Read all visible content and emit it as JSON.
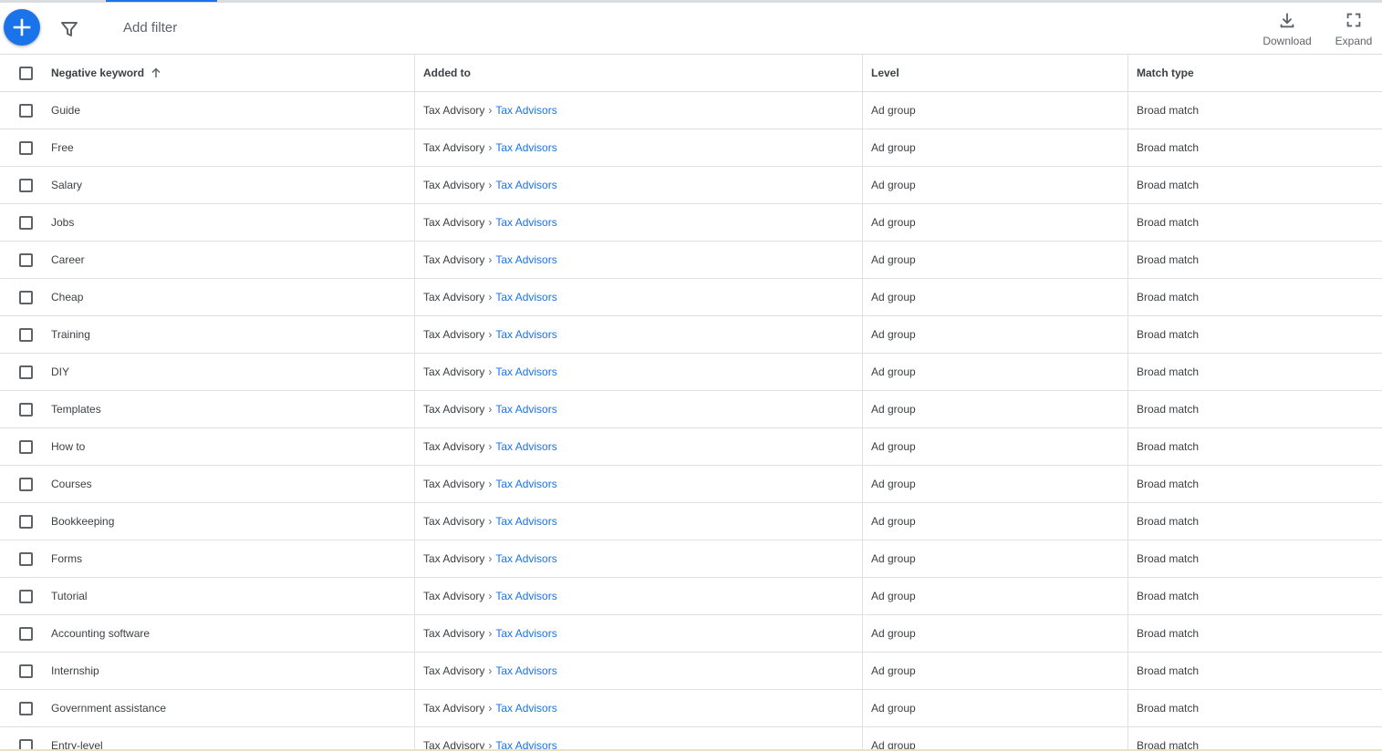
{
  "toolbar": {
    "add_filter_label": "Add filter",
    "download_label": "Download",
    "expand_label": "Expand"
  },
  "table": {
    "columns": {
      "keyword": "Negative keyword",
      "added_to": "Added to",
      "level": "Level",
      "match_type": "Match type"
    },
    "rows": [
      {
        "keyword": "Guide",
        "campaign": "Tax Advisory",
        "separator": "›",
        "ad_group": "Tax Advisors",
        "level": "Ad group",
        "match": "Broad match"
      },
      {
        "keyword": "Free",
        "campaign": "Tax Advisory",
        "separator": "›",
        "ad_group": "Tax Advisors",
        "level": "Ad group",
        "match": "Broad match"
      },
      {
        "keyword": "Salary",
        "campaign": "Tax Advisory",
        "separator": "›",
        "ad_group": "Tax Advisors",
        "level": "Ad group",
        "match": "Broad match"
      },
      {
        "keyword": "Jobs",
        "campaign": "Tax Advisory",
        "separator": "›",
        "ad_group": "Tax Advisors",
        "level": "Ad group",
        "match": "Broad match"
      },
      {
        "keyword": "Career",
        "campaign": "Tax Advisory",
        "separator": "›",
        "ad_group": "Tax Advisors",
        "level": "Ad group",
        "match": "Broad match"
      },
      {
        "keyword": "Cheap",
        "campaign": "Tax Advisory",
        "separator": "›",
        "ad_group": "Tax Advisors",
        "level": "Ad group",
        "match": "Broad match"
      },
      {
        "keyword": "Training",
        "campaign": "Tax Advisory",
        "separator": "›",
        "ad_group": "Tax Advisors",
        "level": "Ad group",
        "match": "Broad match"
      },
      {
        "keyword": "DIY",
        "campaign": "Tax Advisory",
        "separator": "›",
        "ad_group": "Tax Advisors",
        "level": "Ad group",
        "match": "Broad match"
      },
      {
        "keyword": "Templates",
        "campaign": "Tax Advisory",
        "separator": "›",
        "ad_group": "Tax Advisors",
        "level": "Ad group",
        "match": "Broad match"
      },
      {
        "keyword": "How to",
        "campaign": "Tax Advisory",
        "separator": "›",
        "ad_group": "Tax Advisors",
        "level": "Ad group",
        "match": "Broad match"
      },
      {
        "keyword": "Courses",
        "campaign": "Tax Advisory",
        "separator": "›",
        "ad_group": "Tax Advisors",
        "level": "Ad group",
        "match": "Broad match"
      },
      {
        "keyword": "Bookkeeping",
        "campaign": "Tax Advisory",
        "separator": "›",
        "ad_group": "Tax Advisors",
        "level": "Ad group",
        "match": "Broad match"
      },
      {
        "keyword": "Forms",
        "campaign": "Tax Advisory",
        "separator": "›",
        "ad_group": "Tax Advisors",
        "level": "Ad group",
        "match": "Broad match"
      },
      {
        "keyword": "Tutorial",
        "campaign": "Tax Advisory",
        "separator": "›",
        "ad_group": "Tax Advisors",
        "level": "Ad group",
        "match": "Broad match"
      },
      {
        "keyword": "Accounting software",
        "campaign": "Tax Advisory",
        "separator": "›",
        "ad_group": "Tax Advisors",
        "level": "Ad group",
        "match": "Broad match"
      },
      {
        "keyword": "Internship",
        "campaign": "Tax Advisory",
        "separator": "›",
        "ad_group": "Tax Advisors",
        "level": "Ad group",
        "match": "Broad match"
      },
      {
        "keyword": "Government assistance",
        "campaign": "Tax Advisory",
        "separator": "›",
        "ad_group": "Tax Advisors",
        "level": "Ad group",
        "match": "Broad match"
      },
      {
        "keyword": "Entry-level",
        "campaign": "Tax Advisory",
        "separator": "›",
        "ad_group": "Tax Advisors",
        "level": "Ad group",
        "match": "Broad match"
      }
    ]
  },
  "colors": {
    "accent": "#1a73e8",
    "text": "#3c4043",
    "muted": "#5f6368",
    "divider": "#e0e0e0"
  },
  "icons": {
    "fab": "plus-icon",
    "filter": "filter-icon",
    "sort": "arrow-up-icon",
    "download": "download-icon",
    "expand": "fullscreen-icon"
  }
}
